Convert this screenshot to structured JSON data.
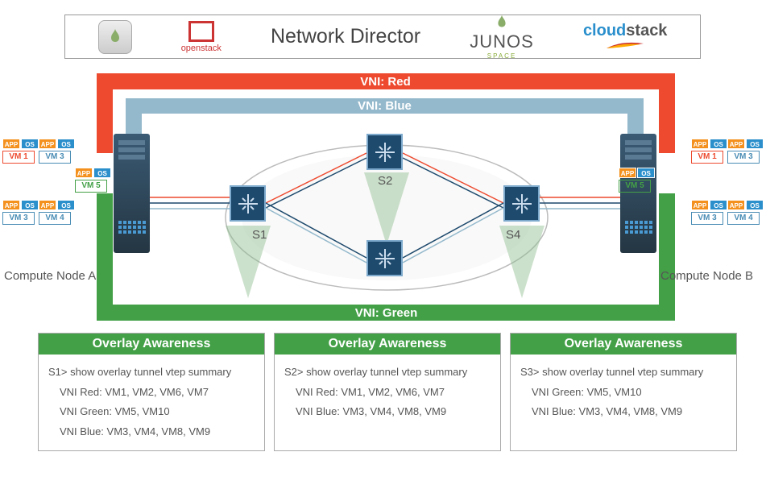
{
  "header": {
    "title": "Network Director",
    "openstack": "openstack",
    "junos": "JUNOS",
    "junos_sub": "SPACE",
    "cloudstack_cloud": "cloud",
    "cloudstack_stack": "stack"
  },
  "vni": {
    "red": "VNI: Red",
    "blue": "VNI: Blue",
    "green": "VNI: Green"
  },
  "switches": {
    "s1": "S1",
    "s2": "S2",
    "s3": "",
    "s4": "S4"
  },
  "compute": {
    "a": "Compute Node A",
    "b": "Compute Node B"
  },
  "vms": {
    "app": "APP",
    "os": "OS",
    "vm1": "VM 1",
    "vm3": "VM 3",
    "vm4": "VM 4",
    "vm5": "VM 5"
  },
  "panels": [
    {
      "title": "Overlay Awareness",
      "lines": [
        "S1> show overlay tunnel vtep summary",
        "VNI Red: VM1, VM2, VM6, VM7",
        "VNI Green: VM5, VM10",
        "VNI Blue: VM3, VM4, VM8, VM9"
      ]
    },
    {
      "title": "Overlay Awareness",
      "lines": [
        "S2> show overlay tunnel vtep summary",
        "VNI Red: VM1, VM2,  VM6, VM7",
        "VNI Blue: VM3, VM4, VM8, VM9"
      ]
    },
    {
      "title": "Overlay Awareness",
      "lines": [
        "S3> show overlay tunnel vtep summary",
        "VNI Green: VM5, VM10",
        "VNI Blue: VM3, VM4, VM8, VM9"
      ]
    }
  ]
}
